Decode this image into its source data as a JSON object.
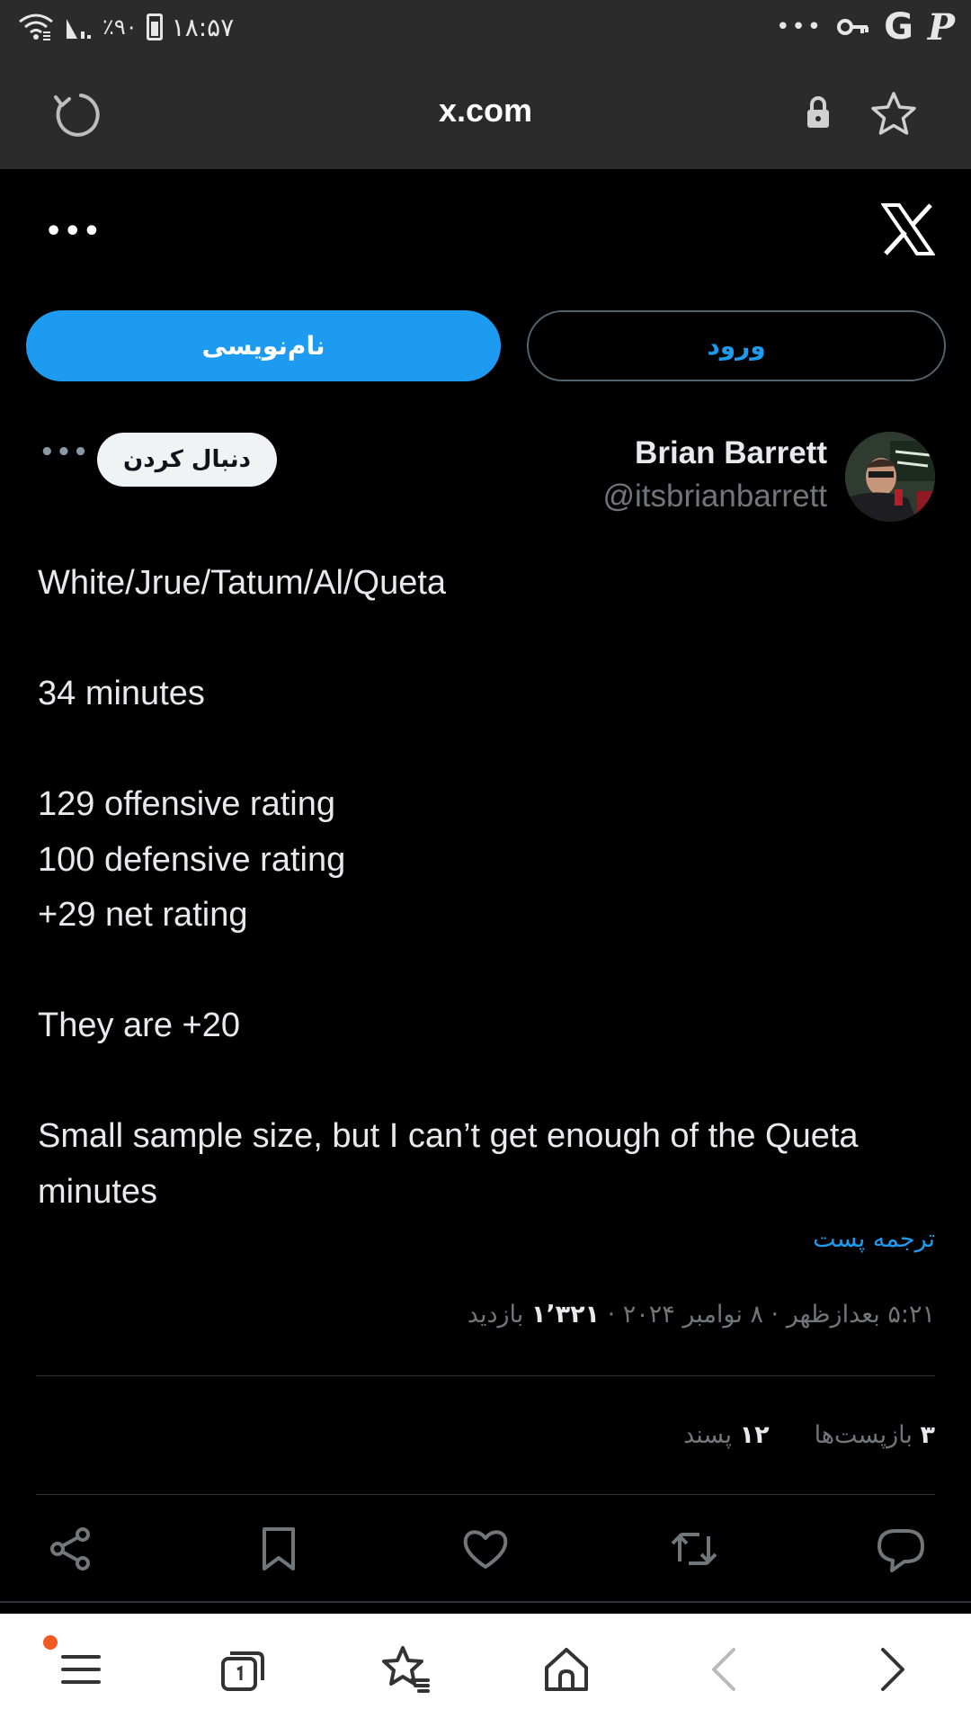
{
  "status_bar": {
    "time": "۱۸:۵۷",
    "battery": "٪۹۰",
    "overflow": "•••",
    "icons": [
      "battery-icon",
      "signal-icon",
      "wifi-icon",
      "key-icon",
      "google-icon",
      "paypal-icon"
    ]
  },
  "browser": {
    "url": "x.com",
    "icons": [
      "reload-icon",
      "lock-icon",
      "star-icon"
    ]
  },
  "x_page": {
    "more": "•••",
    "signup_label": "نام‌نویسی",
    "login_label": "ورود"
  },
  "tweet": {
    "author_name": "Brian Barrett",
    "author_handle": "@itsbrianbarrett",
    "follow_label": "دنبال کردن",
    "more": "•••",
    "body": "White/Jrue/Tatum/Al/Queta\n\n34 minutes\n\n129 offensive rating\n100 defensive rating\n+29 net rating\n\nThey are +20\n\nSmall sample size, but I can’t get enough of the Queta minutes",
    "translate_label": "ترجمه پست",
    "timestamp": "۵:۲۱ بعدازظهر · ۸ نوامبر ۲۰۲۴ · ",
    "views_count": "۱٬۳۲۱",
    "views_label": " بازدید",
    "reposts_count": "۳",
    "reposts_label": " بازپست‌ها",
    "likes_count": "۱۲",
    "likes_label": " پسند"
  },
  "actions": [
    "reply-icon",
    "retweet-icon",
    "like-icon",
    "bookmark-icon",
    "share-icon"
  ],
  "bottom_nav": [
    "menu-icon",
    "tabs-icon",
    "favorites-icon",
    "home-icon",
    "back-icon",
    "forward-icon"
  ],
  "colors": {
    "accent": "#1d9bf0",
    "background": "#000000",
    "browser_chrome": "#2b2b2b",
    "notification_dot": "#f15a22"
  }
}
